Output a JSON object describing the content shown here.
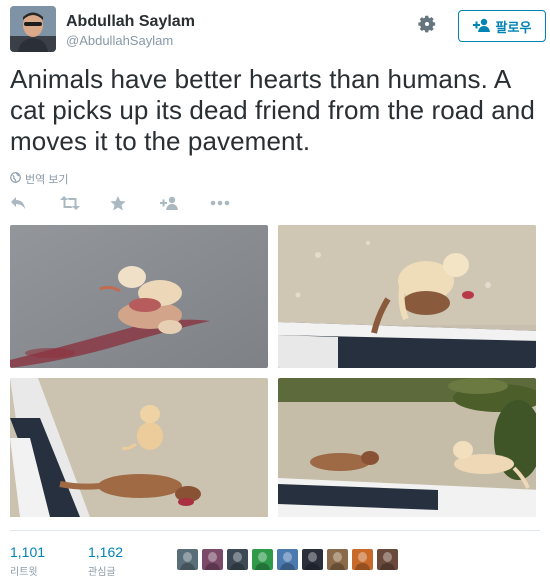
{
  "author": {
    "display_name": "Abdullah Saylam",
    "handle": "@AbdullahSaylam"
  },
  "header": {
    "settings_icon": "gear-icon",
    "follow_label": "팔로우",
    "follow_icon": "add-user-icon",
    "accent": "#0084b4"
  },
  "tweet": {
    "text": "Animals have better hearts than humans. A cat picks up its dead friend from the road and moves it to the pavement.",
    "translate_label": "번역 보기"
  },
  "actions": [
    "reply-icon",
    "retweet-icon",
    "favorite-icon",
    "follow-icon",
    "more-icon"
  ],
  "photos": [
    {
      "name": "photo-1"
    },
    {
      "name": "photo-2"
    },
    {
      "name": "photo-3"
    },
    {
      "name": "photo-4"
    }
  ],
  "stats": {
    "retweets": {
      "count": "1,101",
      "label": "리트윗"
    },
    "favorites": {
      "count": "1,162",
      "label": "관심글"
    }
  },
  "likers": [
    "#5a6e7a",
    "#7a4a68",
    "#3d4a56",
    "#2e9a4a",
    "#4a7ab0",
    "#2a2f3a",
    "#8a6a48",
    "#c86a2a",
    "#6a4a3a"
  ]
}
